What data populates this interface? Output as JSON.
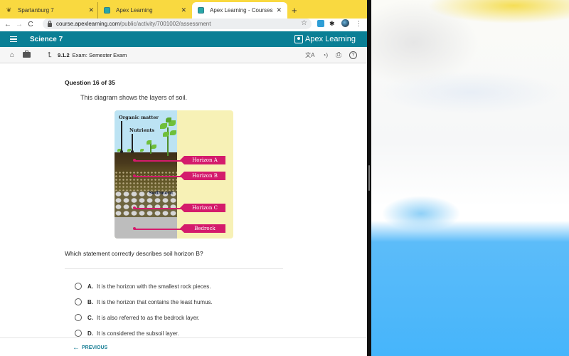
{
  "browser": {
    "tabs": [
      {
        "title": "Spartanburg 7",
        "active": false,
        "icon": "leaf-favicon"
      },
      {
        "title": "Apex Learning",
        "active": false,
        "icon": "apex-favicon"
      },
      {
        "title": "Apex Learning - Courses",
        "active": true,
        "icon": "apex-favicon"
      }
    ],
    "close_glyph": "✕",
    "new_tab_glyph": "+",
    "url_host": "course.apexlearning.com",
    "url_path": "/public/activity/7001002/assessment",
    "nav": {
      "back": "←",
      "forward": "→",
      "reload": "C"
    },
    "star_glyph": "☆",
    "menu_glyph": "⋮",
    "puzzle_glyph": "✱"
  },
  "app": {
    "course_title": "Science 7",
    "brand_name": "Apex Learning",
    "brand_color": "#0a7f95",
    "breadcrumb": {
      "number": "9.1.2",
      "label": "Exam:  Semester Exam"
    },
    "icons": {
      "home": "⌂",
      "up": "⮤",
      "translate": "文A",
      "read_aloud": "◔)",
      "print": "⎙",
      "help": "?"
    }
  },
  "question": {
    "number_label": "Question 16 of 35",
    "intro": "This diagram shows the layers of soil.",
    "diagram": {
      "labels": [
        "Organic matter",
        "Nutrients",
        "Sediment"
      ],
      "horizons": [
        "Horizon A",
        "Horizon B",
        "Horizon C",
        "Bedrock"
      ],
      "tag_color": "#d41b6c"
    },
    "prompt": "Which statement correctly describes soil horizon B?",
    "options": [
      {
        "letter": "A.",
        "text": "It is the horizon with the smallest rock pieces.",
        "selected": false
      },
      {
        "letter": "B.",
        "text": "It is the horizon that contains the least humus.",
        "selected": false
      },
      {
        "letter": "C.",
        "text": "It is also referred to as the bedrock layer.",
        "selected": false
      },
      {
        "letter": "D.",
        "text": "It is considered the subsoil layer.",
        "selected": false
      }
    ]
  },
  "footer": {
    "previous_label": "PREVIOUS",
    "previous_arrow": "←"
  }
}
